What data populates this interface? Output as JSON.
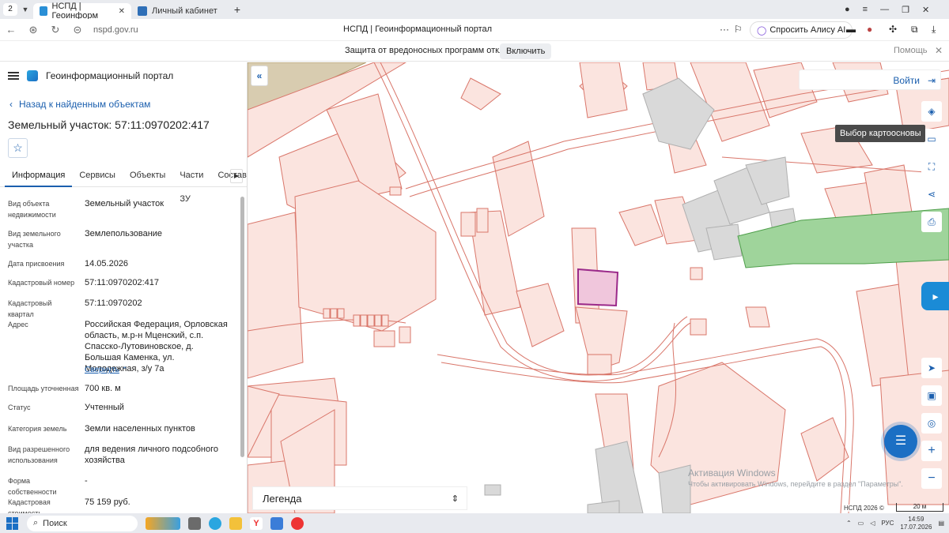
{
  "browser": {
    "tab_count": "2",
    "tabs": [
      {
        "title": "НСПД | Геоинформ"
      },
      {
        "title": "Личный кабинет"
      }
    ],
    "url_host": "nspd.gov.ru",
    "page_title": "НСПД | Геоинформационный портал",
    "alice_label": "Спросить Алису AI"
  },
  "infobar": {
    "text": "Защита от вредоносных программ отключена",
    "button": "Включить",
    "help": "Помощь"
  },
  "panel": {
    "app_title": "Геоинформационный портал",
    "back_label": "Назад к найденным объектам",
    "object_title": "Земельный участок: 57:11:0970202:417",
    "tabs": [
      "Информация",
      "Сервисы",
      "Объекты",
      "Части ЗУ",
      "Состав"
    ],
    "collapse_label": "Свернуть",
    "fields": [
      {
        "label": "Вид объекта недвижимости",
        "value": "Земельный участок"
      },
      {
        "label": "Вид земельного участка",
        "value": "Землепользование"
      },
      {
        "label": "Дата присвоения",
        "value": "14.05.2026"
      },
      {
        "label": "Кадастровый номер",
        "value": "57:11:0970202:417"
      },
      {
        "label": "Кадастровый квартал",
        "value": "57:11:0970202"
      },
      {
        "label": "Адрес",
        "value": "Российская Федерация, Орловская область, м.р-н Мценский, с.п. Спасско-Лутовиновское, д. Большая Каменка, ул. Молодежная, з/у 7а"
      },
      {
        "label": "Площадь уточненная",
        "value": "700 кв. м"
      },
      {
        "label": "Статус",
        "value": "Учтенный"
      },
      {
        "label": "Категория земель",
        "value": "Земли населенных пунктов"
      },
      {
        "label": "Вид разрешенного использования",
        "value": "для ведения личного подсобного хозяйства"
      },
      {
        "label": "Форма собственности",
        "value": "-"
      },
      {
        "label": "Кадастровая стоимость",
        "value": "75 159 руб."
      }
    ]
  },
  "map": {
    "login_label": "Войти",
    "tooltip": "Выбор картоосновы",
    "legend_label": "Легенда",
    "watermark_title": "Активация Windows",
    "watermark_sub": "Чтобы активировать Windows, перейдите в раздел \"Параметры\".",
    "copyright": "НСПД 2026 ©",
    "scale": "20 м",
    "colors": {
      "parcel_fill": "#fbe4df",
      "parcel_line": "#d9766a",
      "selected_fill": "#f0c6dc",
      "selected_line": "#9b2a8a",
      "green": "#9fd49b",
      "building": "#d9d9d9"
    }
  },
  "taskbar": {
    "search_label": "Поиск",
    "lang": "РУС",
    "time": "14:59",
    "date": "17.07.2026"
  }
}
